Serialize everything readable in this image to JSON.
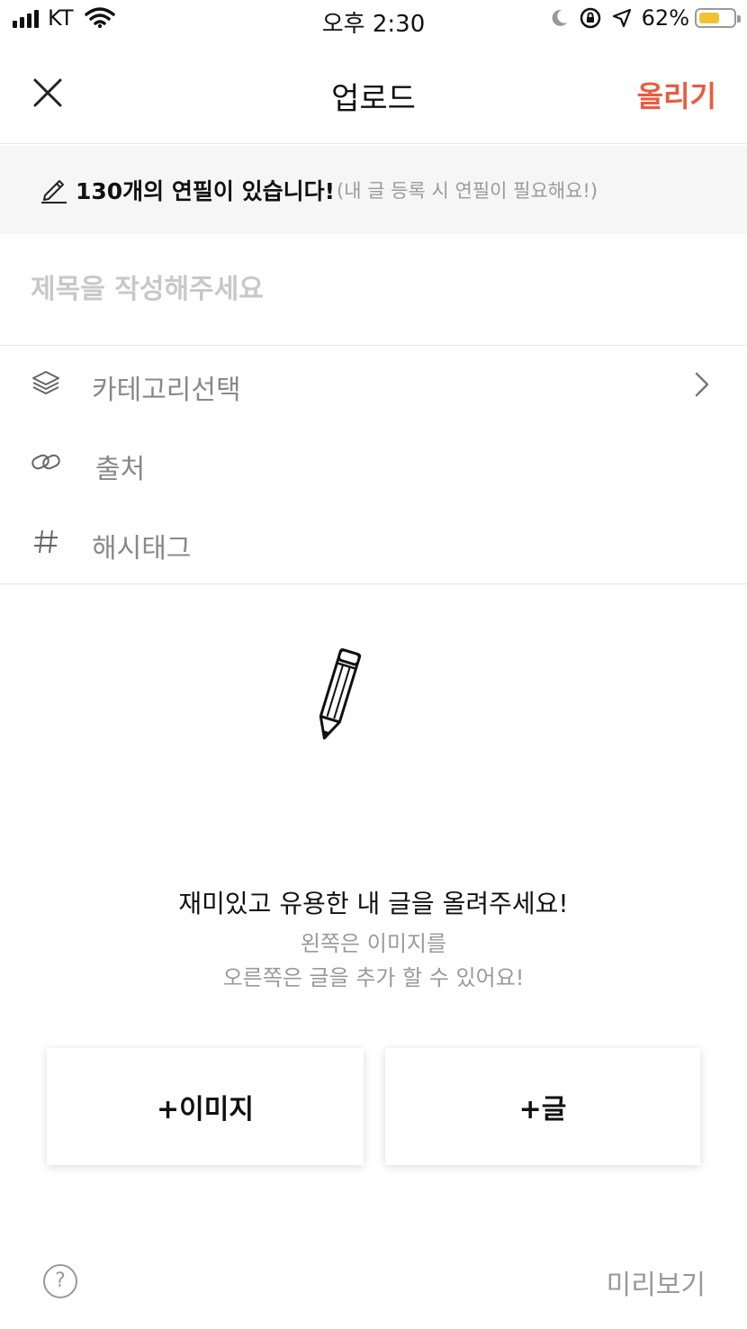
{
  "status_bar": {
    "carrier": "KT",
    "time": "오후 2:30",
    "battery_percent": "62%",
    "battery_level": 0.62,
    "icons": [
      "signal-icon",
      "wifi-icon",
      "moon-icon",
      "rotation-lock-icon",
      "location-icon",
      "battery-icon"
    ]
  },
  "header": {
    "title": "업로드",
    "close_icon": "close-icon",
    "post_label": "올리기",
    "post_color": "#ea5b3f"
  },
  "banner": {
    "main": "130개의 연필이 있습니다!",
    "sub": "(내 글 등록 시 연필이 필요해요!)",
    "icon": "pencil-icon"
  },
  "title_field": {
    "placeholder": "제목을 작성해주세요",
    "value": ""
  },
  "options": [
    {
      "label": "카테고리선택",
      "icon": "layers-icon",
      "chevron": true
    },
    {
      "label": "출처",
      "icon": "link-icon",
      "chevron": false
    },
    {
      "label": "해시태그",
      "icon": "hashtag-icon",
      "chevron": false
    }
  ],
  "prompt": {
    "main": "재미있고 유용한 내 글을 올려주세요!",
    "sub_line1": "왼쪽은 이미지를",
    "sub_line2": "오른쪽은 글을 추가 할 수 있어요!"
  },
  "buttons": {
    "add_image": "+이미지",
    "add_text": "+글"
  },
  "footer": {
    "help_label": "?",
    "preview_label": "미리보기"
  }
}
